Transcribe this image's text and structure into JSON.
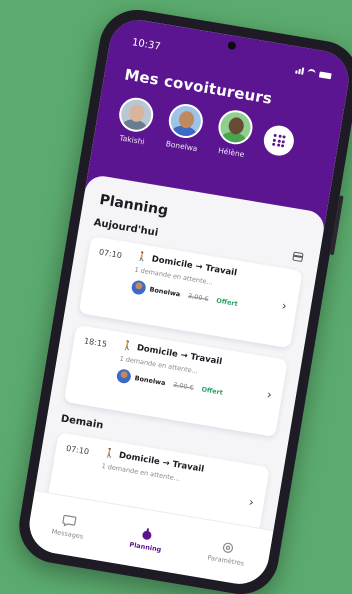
{
  "status_bar": {
    "time": "10:37"
  },
  "header": {
    "title": "Mes covoitureurs"
  },
  "drivers": [
    {
      "name": "Takishi",
      "skin": "#d8b49a",
      "shirt": "#6c7c8f"
    },
    {
      "name": "Bonelwa",
      "skin": "#c08a5e",
      "shirt": "#3e69c4"
    },
    {
      "name": "Hélène",
      "skin": "#6b4a35",
      "shirt": "#4aa34f"
    }
  ],
  "planning": {
    "title": "Planning",
    "days": [
      {
        "label": "Aujourd'hui",
        "trips": [
          {
            "time": "07:10",
            "route": "Domicile → Travail",
            "status": "1 demande en attente...",
            "driver": "Bonelwa",
            "price": "3,00 €",
            "offer": "Offert"
          },
          {
            "time": "18:15",
            "route": "Domicile → Travail",
            "status": "1 demande en attente...",
            "driver": "Bonelwa",
            "price": "3,00 €",
            "offer": "Offert"
          }
        ]
      },
      {
        "label": "Demain",
        "trips": [
          {
            "time": "07:10",
            "route": "Domicile → Travail",
            "status": "1 demande en attente..."
          }
        ]
      }
    ]
  },
  "nav": {
    "messages": "Messages",
    "planning": "Planning",
    "settings": "Paramètres"
  },
  "colors": {
    "brand": "#5b1590",
    "offer": "#2fa36b",
    "background": "#5bab6e"
  }
}
